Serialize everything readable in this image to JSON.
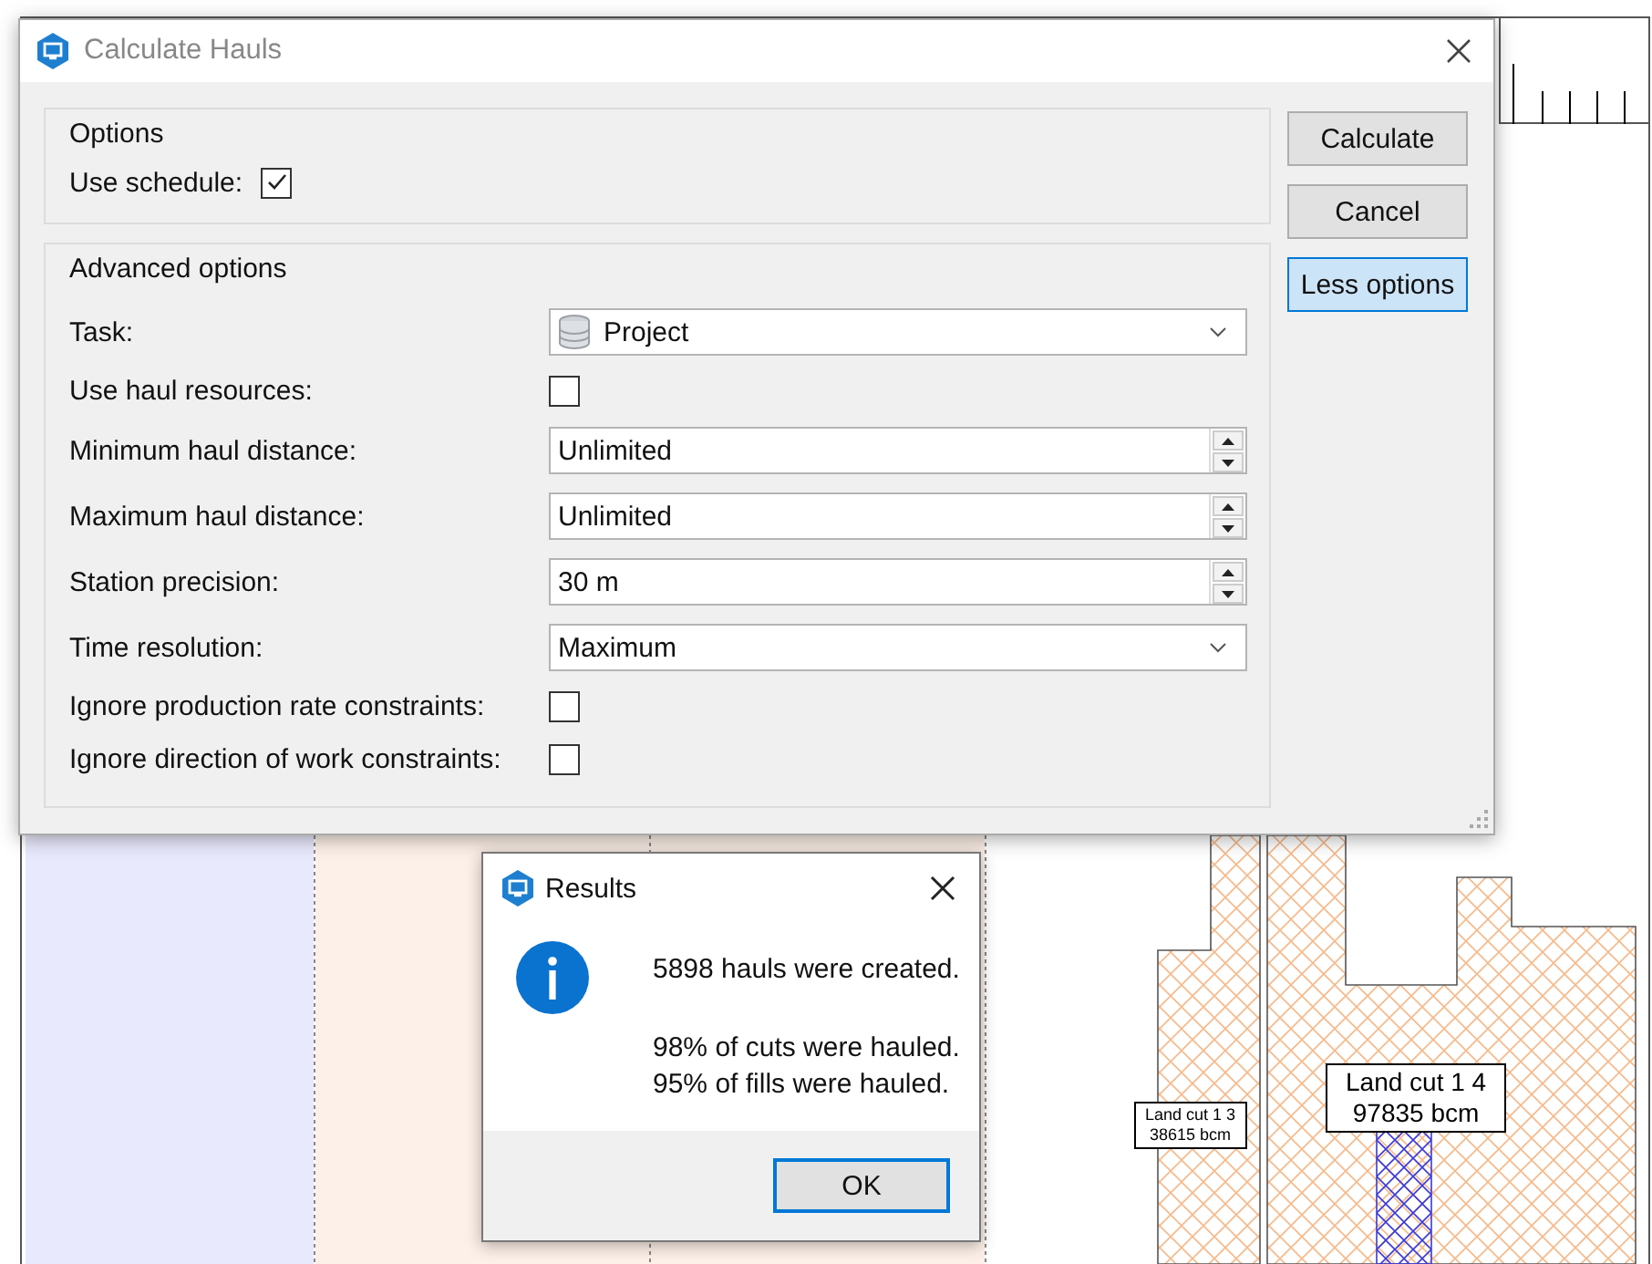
{
  "main_dialog": {
    "title": "Calculate Hauls",
    "options": {
      "title": "Options",
      "use_schedule": {
        "label": "Use schedule:",
        "checked": true
      }
    },
    "advanced": {
      "title": "Advanced options",
      "rows": [
        {
          "kind": "dropdown",
          "label": "Task:",
          "value": "Project",
          "has_icon": true
        },
        {
          "kind": "checkbox",
          "label": "Use haul resources:",
          "checked": false
        },
        {
          "kind": "spinner",
          "label": "Minimum haul distance:",
          "value": "Unlimited"
        },
        {
          "kind": "spinner",
          "label": "Maximum haul distance:",
          "value": "Unlimited"
        },
        {
          "kind": "spinner",
          "label": "Station precision:",
          "value": "30 m"
        },
        {
          "kind": "dropdown",
          "label": "Time resolution:",
          "value": "Maximum",
          "has_icon": false
        },
        {
          "kind": "checkbox",
          "label": "Ignore production rate constraints:",
          "checked": false
        },
        {
          "kind": "checkbox",
          "label": "Ignore direction of work constraints:",
          "checked": false
        }
      ]
    },
    "buttons": [
      {
        "label": "Calculate",
        "highlighted": false
      },
      {
        "label": "Cancel",
        "highlighted": false
      },
      {
        "label": "Less options",
        "highlighted": true
      }
    ]
  },
  "results_dialog": {
    "title": "Results",
    "lines": [
      "5898 hauls were created.",
      "98% of cuts were hauled.",
      "95% of fills were hauled."
    ],
    "button": {
      "label": "OK",
      "highlighted": true
    }
  },
  "canvas": {
    "labels": [
      {
        "name": "Land cut 1 3",
        "volume": "38615 bcm",
        "kind": "small"
      },
      {
        "name": "Land cut 1 4",
        "volume": "97835 bcm",
        "kind": "large"
      }
    ]
  }
}
